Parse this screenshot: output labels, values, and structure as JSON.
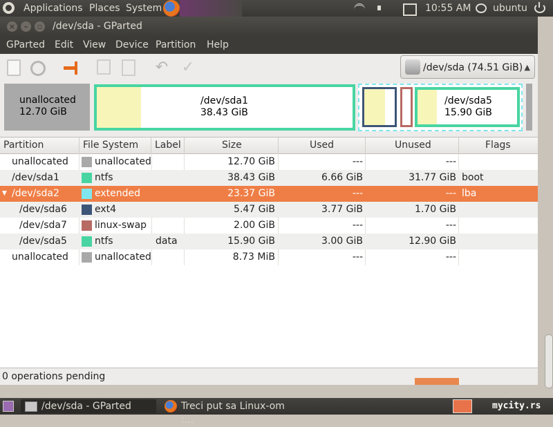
{
  "top_panel": {
    "applications": "Applications",
    "places": "Places",
    "system": "System",
    "clock": "10:55 AM",
    "user": "ubuntu"
  },
  "window": {
    "title": "/dev/sda - GParted",
    "menu": [
      "GParted",
      "Edit",
      "View",
      "Device",
      "Partition",
      "Help"
    ],
    "device_selector": "/dev/sda  (74.51 GiB)"
  },
  "partition_map": {
    "unalloc1": {
      "name": "unallocated",
      "size": "12.70 GiB"
    },
    "sda1": {
      "name": "/dev/sda1",
      "size": "38.43 GiB"
    },
    "sda5": {
      "name": "/dev/sda5",
      "size": "15.90 GiB"
    }
  },
  "table": {
    "headers": [
      "Partition",
      "File System",
      "Label",
      "Size",
      "Used",
      "Unused",
      "Flags"
    ],
    "rows": [
      {
        "partition": "unallocated",
        "fs": "unallocated",
        "fs_color": "#a9a9a9",
        "label": "",
        "size": "12.70 GiB",
        "used": "---",
        "unused": "---",
        "flags": ""
      },
      {
        "partition": "/dev/sda1",
        "fs": "ntfs",
        "fs_color": "#48d5a2",
        "label": "",
        "size": "38.43 GiB",
        "used": "6.66 GiB",
        "unused": "31.77 GiB",
        "flags": "boot"
      },
      {
        "partition": "/dev/sda2",
        "fs": "extended",
        "fs_color": "#7fe6ef",
        "label": "",
        "size": "23.37 GiB",
        "used": "---",
        "unused": "---",
        "flags": "lba"
      },
      {
        "partition": "/dev/sda6",
        "fs": "ext4",
        "fs_color": "#3d5577",
        "label": "",
        "size": "5.47 GiB",
        "used": "3.77 GiB",
        "unused": "1.70 GiB",
        "flags": ""
      },
      {
        "partition": "/dev/sda7",
        "fs": "linux-swap",
        "fs_color": "#b86a64",
        "label": "",
        "size": "2.00 GiB",
        "used": "---",
        "unused": "---",
        "flags": ""
      },
      {
        "partition": "/dev/sda5",
        "fs": "ntfs",
        "fs_color": "#48d5a2",
        "label": "data",
        "size": "15.90 GiB",
        "used": "3.00 GiB",
        "unused": "12.90 GiB",
        "flags": ""
      },
      {
        "partition": "unallocated",
        "fs": "unallocated",
        "fs_color": "#a9a9a9",
        "label": "",
        "size": "8.73 MiB",
        "used": "---",
        "unused": "---",
        "flags": ""
      }
    ]
  },
  "status": "0 operations pending",
  "taskbar": {
    "gparted": "/dev/sda - GParted",
    "browser": "Treci put sa Linux-om :...",
    "watermark": "mycity.rs"
  }
}
